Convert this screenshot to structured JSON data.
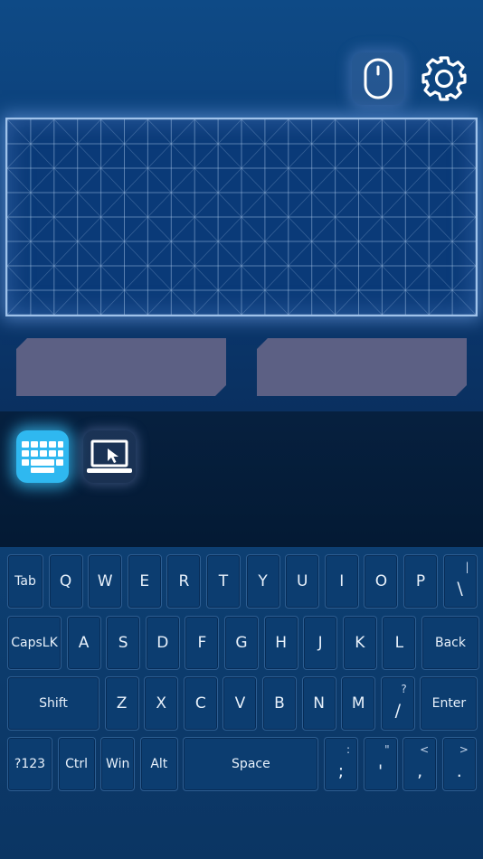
{
  "colors": {
    "background": "#0e4a86",
    "touchpad_border": "#9fc2ea",
    "click_button": "#5c6084",
    "active_mode": "#2fb8f0",
    "key_fill": "#0c3d70",
    "key_text": "#e8f1fb"
  },
  "toolbar": {
    "mouse_icon": "mouse-icon",
    "settings_icon": "gear-icon"
  },
  "modes": {
    "keyboard_icon": "keyboard-icon",
    "screen_icon": "laptop-cursor-icon",
    "active": "keyboard"
  },
  "keyboard": {
    "row1": [
      {
        "label": "Tab"
      },
      {
        "label": "Q"
      },
      {
        "label": "W"
      },
      {
        "label": "E"
      },
      {
        "label": "R"
      },
      {
        "label": "T"
      },
      {
        "label": "Y"
      },
      {
        "label": "U"
      },
      {
        "label": "I"
      },
      {
        "label": "O"
      },
      {
        "label": "P"
      },
      {
        "label": "\\",
        "shift": "|"
      }
    ],
    "row2": [
      {
        "label": "CapsLK"
      },
      {
        "label": "A"
      },
      {
        "label": "S"
      },
      {
        "label": "D"
      },
      {
        "label": "F"
      },
      {
        "label": "G"
      },
      {
        "label": "H"
      },
      {
        "label": "J"
      },
      {
        "label": "K"
      },
      {
        "label": "L"
      },
      {
        "label": "Back"
      }
    ],
    "row3": [
      {
        "label": "Shift"
      },
      {
        "label": "Z"
      },
      {
        "label": "X"
      },
      {
        "label": "C"
      },
      {
        "label": "V"
      },
      {
        "label": "B"
      },
      {
        "label": "N"
      },
      {
        "label": "M"
      },
      {
        "label": "/",
        "shift": "?"
      },
      {
        "label": "Enter"
      }
    ],
    "row4": [
      {
        "label": "?123"
      },
      {
        "label": "Ctrl"
      },
      {
        "label": "Win"
      },
      {
        "label": "Alt"
      },
      {
        "label": "Space"
      },
      {
        "label": ";",
        "shift": ":"
      },
      {
        "label": "'",
        "shift": "\""
      },
      {
        "label": ",",
        "shift": "<"
      },
      {
        "label": ".",
        "shift": ">"
      }
    ]
  }
}
